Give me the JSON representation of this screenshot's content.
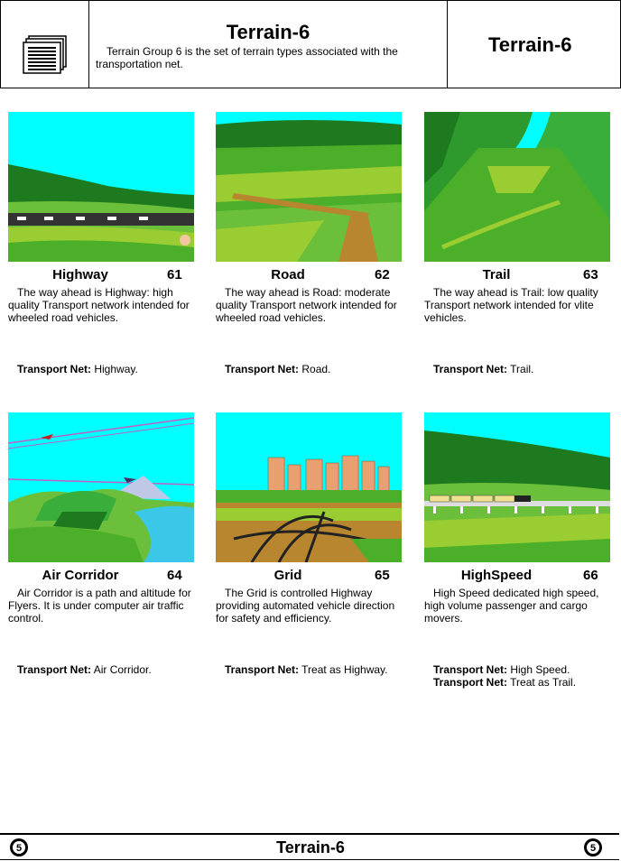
{
  "header": {
    "title": "Terrain-6",
    "description": "Terrain Group 6 is the set of terrain types associated with the transportation net.",
    "right_title": "Terrain-6",
    "icon": "document-stack-icon"
  },
  "cards": [
    {
      "name": "Highway",
      "number": "61",
      "description": "The way ahead is Highway: high quality Transport network intended for wheeled road vehicles.",
      "transport": [
        {
          "label": "Transport Net:",
          "value": " Highway."
        }
      ]
    },
    {
      "name": "Road",
      "number": "62",
      "description": "The way ahead is Road: moderate quality Transport network intended for wheeled road vehicles.",
      "transport": [
        {
          "label": "Transport Net:",
          "value": " Road."
        }
      ]
    },
    {
      "name": "Trail",
      "number": "63",
      "description": "The way ahead is Trail: low quality Transport network intended for vlite vehicles.",
      "transport": [
        {
          "label": "Transport Net:",
          "value": " Trail."
        }
      ]
    },
    {
      "name": "Air Corridor",
      "number": "64",
      "description": "Air Corridor is a path and altitude for Flyers. It is under computer air traffic control.",
      "transport": [
        {
          "label": "Transport Net:",
          "value": " Air Corridor."
        }
      ]
    },
    {
      "name": "Grid",
      "number": "65",
      "description": "The Grid is controlled Highway providing automated vehicle direction for safety and efficiency.",
      "transport": [
        {
          "label": "Transport Net:",
          "value": " Treat as Highway."
        }
      ]
    },
    {
      "name": "HighSpeed",
      "number": "66",
      "description": "High Speed dedicated high speed, high volume passenger and cargo movers.",
      "transport": [
        {
          "label": "Transport Net:",
          "value": " High Speed."
        },
        {
          "label": "Transport Net:",
          "value": " Treat as Trail."
        }
      ]
    }
  ],
  "footer": {
    "title": "Terrain-6",
    "badge_left": "5",
    "badge_right": "5"
  },
  "colors": {
    "sky": "#00FFFF",
    "dark_green": "#1E7A1E",
    "mid_green": "#4CAF2A",
    "light_green": "#9ACD32",
    "road": "#B8862E",
    "water": "#3BC7E8"
  }
}
